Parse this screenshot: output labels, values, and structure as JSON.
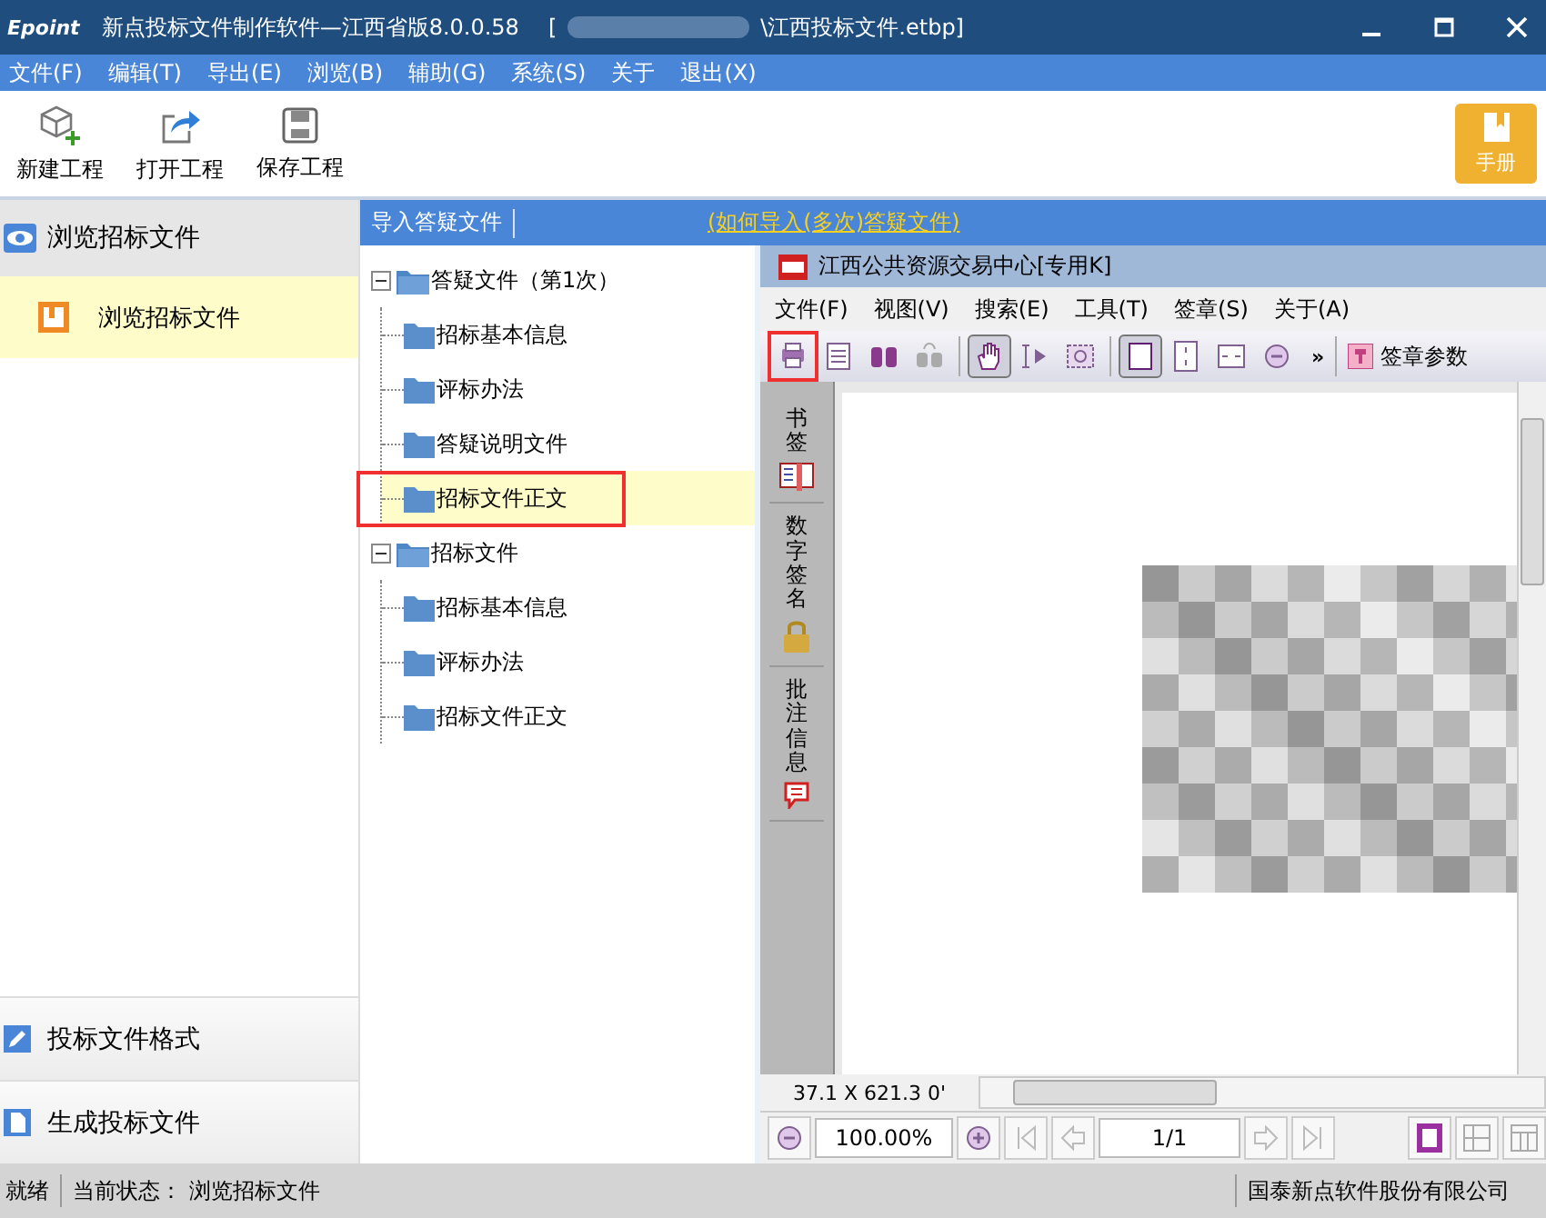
{
  "window": {
    "app_name": "Epoint",
    "title": "新点投标文件制作软件—江西省版8.0.0.58",
    "file_path_start": "[",
    "file_path_end": "\\江西投标文件.etbp]"
  },
  "menu": [
    "文件(F)",
    "编辑(T)",
    "导出(E)",
    "浏览(B)",
    "辅助(G)",
    "系统(S)",
    "关于",
    "退出(X)"
  ],
  "toolbar": [
    {
      "label": "新建工程",
      "kind": "new"
    },
    {
      "label": "打开工程",
      "kind": "open"
    },
    {
      "label": "保存工程",
      "kind": "save"
    }
  ],
  "manual_button": "手册",
  "sidebar": {
    "header": "浏览招标文件",
    "items": [
      {
        "label": "浏览招标文件",
        "selected": true
      }
    ],
    "footer_items": [
      {
        "label": "投标文件格式",
        "kind": "edit"
      },
      {
        "label": "生成投标文件",
        "kind": "doc"
      }
    ]
  },
  "tree_bar": {
    "import_button": "导入答疑文件",
    "help_link": "(如何导入(多次)答疑文件)"
  },
  "tree": [
    {
      "label": "答疑文件（第1次）",
      "expanded": true,
      "children": [
        {
          "label": "招标基本信息",
          "selected": false,
          "highlighted": false
        },
        {
          "label": "评标办法",
          "selected": false,
          "highlighted": false
        },
        {
          "label": "答疑说明文件",
          "selected": false,
          "highlighted": false
        },
        {
          "label": "招标文件正文",
          "selected": true,
          "highlighted": true
        }
      ]
    },
    {
      "label": "招标文件",
      "expanded": true,
      "children": [
        {
          "label": "招标基本信息",
          "selected": false,
          "highlighted": false
        },
        {
          "label": "评标办法",
          "selected": false,
          "highlighted": false
        },
        {
          "label": "招标文件正文",
          "selected": false,
          "highlighted": false
        }
      ]
    }
  ],
  "viewer": {
    "title": "江西公共资源交易中心[专用K]",
    "menu": [
      "文件(F)",
      "视图(V)",
      "搜索(E)",
      "工具(T)",
      "签章(S)",
      "关于(A)"
    ],
    "tools": [
      {
        "kind": "print",
        "selected": false,
        "highlighted": true
      },
      {
        "kind": "list",
        "selected": false,
        "highlighted": false
      },
      {
        "kind": "find",
        "selected": false,
        "highlighted": false
      },
      {
        "kind": "find-next",
        "selected": false,
        "highlighted": false
      },
      {
        "kind": "hand",
        "selected": true,
        "highlighted": false
      },
      {
        "kind": "select-text",
        "selected": false,
        "highlighted": false
      },
      {
        "kind": "snapshot",
        "selected": false,
        "highlighted": false
      },
      {
        "kind": "single-page",
        "selected": true,
        "highlighted": false
      },
      {
        "kind": "fit-height",
        "selected": false,
        "highlighted": false
      },
      {
        "kind": "fit-width",
        "selected": false,
        "highlighted": false
      },
      {
        "kind": "zoom-out",
        "selected": false,
        "highlighted": false
      }
    ],
    "more": "»",
    "sign_button": "签章参数",
    "side_tabs": [
      {
        "label": "书签",
        "kind": "bookmark"
      },
      {
        "label": "数字签名",
        "kind": "signature"
      },
      {
        "label": "批注信息",
        "kind": "comment"
      }
    ],
    "coordinates": "37.1 X 621.3 0'",
    "zoom": "100.00%",
    "page": "1/1"
  },
  "status_bar": {
    "ready": "就绪",
    "state": "当前状态： 浏览招标文件",
    "company": "国泰新点软件股份有限公司"
  }
}
